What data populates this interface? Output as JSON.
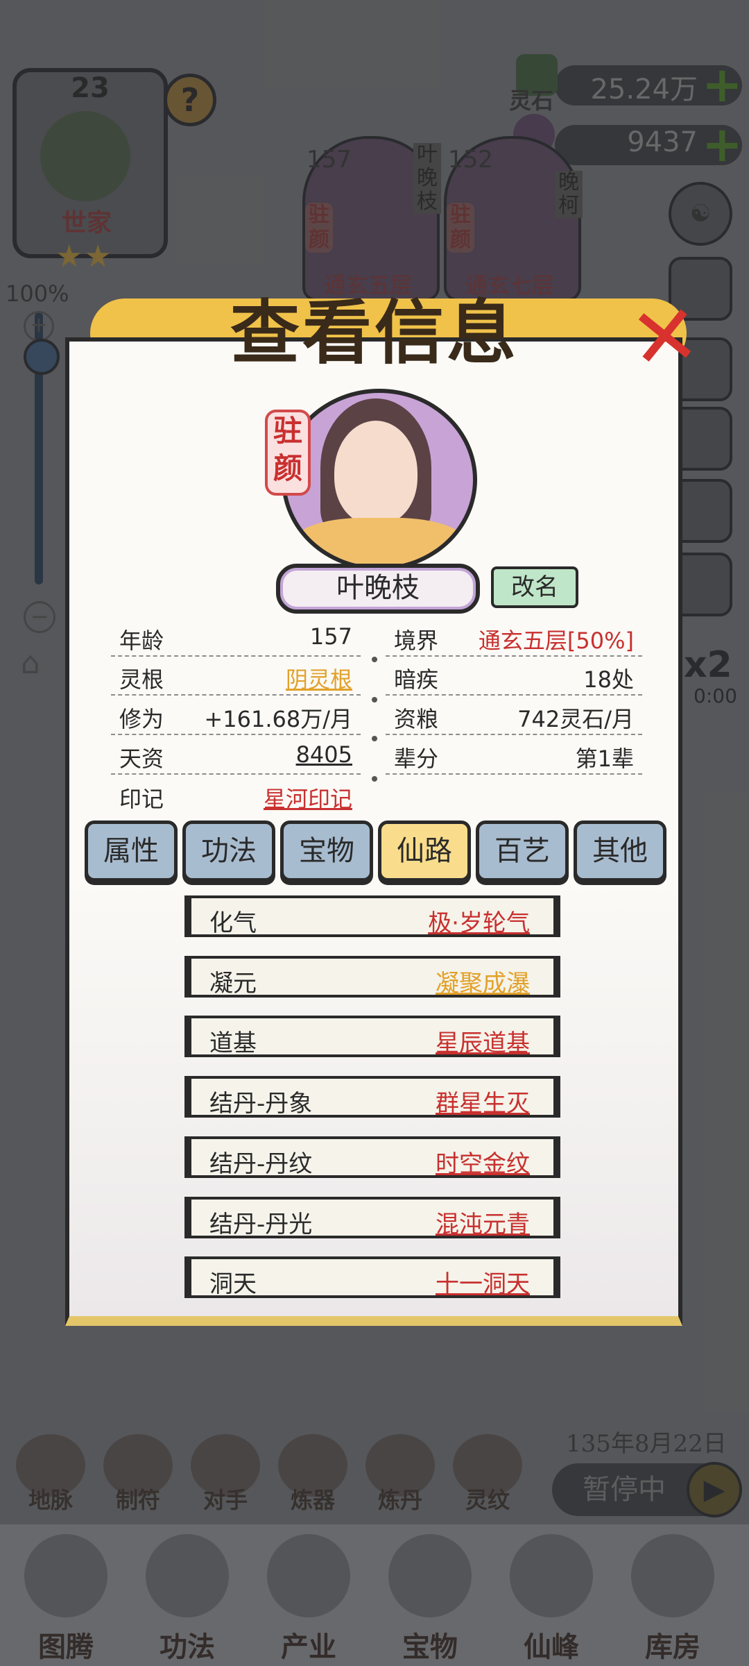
{
  "background": {
    "clan": {
      "level": "23",
      "label": "世家",
      "stars": "★★",
      "help": "?"
    },
    "zoom": {
      "percent": "100%",
      "plus": "+",
      "minus": "−",
      "level": 0.95
    },
    "resources": [
      {
        "name": "灵石",
        "value": "25.24万",
        "plus": "+"
      },
      {
        "name": "仙晶",
        "value": "9437",
        "plus": "+"
      }
    ],
    "characters": [
      {
        "level": "157",
        "name": "叶晚枝",
        "tag": "驻颜",
        "rank": "通玄五层"
      },
      {
        "level": "152",
        "name": "晚柯",
        "tag": "驻颜",
        "rank": "通玄七层"
      }
    ],
    "speed": {
      "multiplier": "x2",
      "time": "0:00"
    },
    "date": "135年8月22日",
    "pause_label": "暂停中",
    "sub_menu": [
      "地脉",
      "制符",
      "对手",
      "炼器",
      "炼丹",
      "灵纹"
    ],
    "nav": [
      "图腾",
      "功法",
      "产业",
      "宝物",
      "仙峰",
      "库房"
    ]
  },
  "modal": {
    "title": "查看信息",
    "portrait_tag": "驻颜",
    "name": "叶晚枝",
    "rename_label": "改名",
    "stats_left": [
      {
        "label": "年龄",
        "value": "157",
        "style": "plain"
      },
      {
        "label": "灵根",
        "value": "阴灵根",
        "style": "orange"
      },
      {
        "label": "修为",
        "value": "+161.68万/月",
        "style": "plain"
      },
      {
        "label": "天资",
        "value": "8405",
        "style": "underline"
      },
      {
        "label": "印记",
        "value": "星河印记",
        "style": "red"
      }
    ],
    "stats_right": [
      {
        "label": "境界",
        "value": "通玄五层[50%]",
        "style": "redplain"
      },
      {
        "label": "暗疾",
        "value": "18处",
        "style": "plain"
      },
      {
        "label": "资粮",
        "value": "742灵石/月",
        "style": "plain"
      },
      {
        "label": "辈分",
        "value": "第1辈",
        "style": "plain"
      }
    ],
    "tabs": [
      "属性",
      "功法",
      "宝物",
      "仙路",
      "百艺",
      "其他"
    ],
    "active_tab": "仙路",
    "path_rows": [
      {
        "label": "化气",
        "value": "极·岁轮气",
        "color": "#c8302f"
      },
      {
        "label": "凝元",
        "value": "凝聚成瀑",
        "color": "#e2a12a"
      },
      {
        "label": "道基",
        "value": "星辰道基",
        "color": "#c8302f"
      },
      {
        "label": "结丹-丹象",
        "value": "群星生灭",
        "color": "#c8302f"
      },
      {
        "label": "结丹-丹纹",
        "value": "时空金纹",
        "color": "#c8302f"
      },
      {
        "label": "结丹-丹光",
        "value": "混沌元青",
        "color": "#c8302f"
      },
      {
        "label": "洞天",
        "value": "十一洞天",
        "color": "#c8302f"
      }
    ]
  },
  "colors": {
    "accent_red": "#c8302f",
    "accent_orange": "#e2a12a",
    "tab_active": "#f9dd8c",
    "tab_inactive": "#a8bccf",
    "rename_green": "#bfe6c8"
  },
  "icons": {
    "close": "close-icon",
    "play": "play-icon",
    "help": "help-icon",
    "settings": "yin-yang-icon"
  }
}
